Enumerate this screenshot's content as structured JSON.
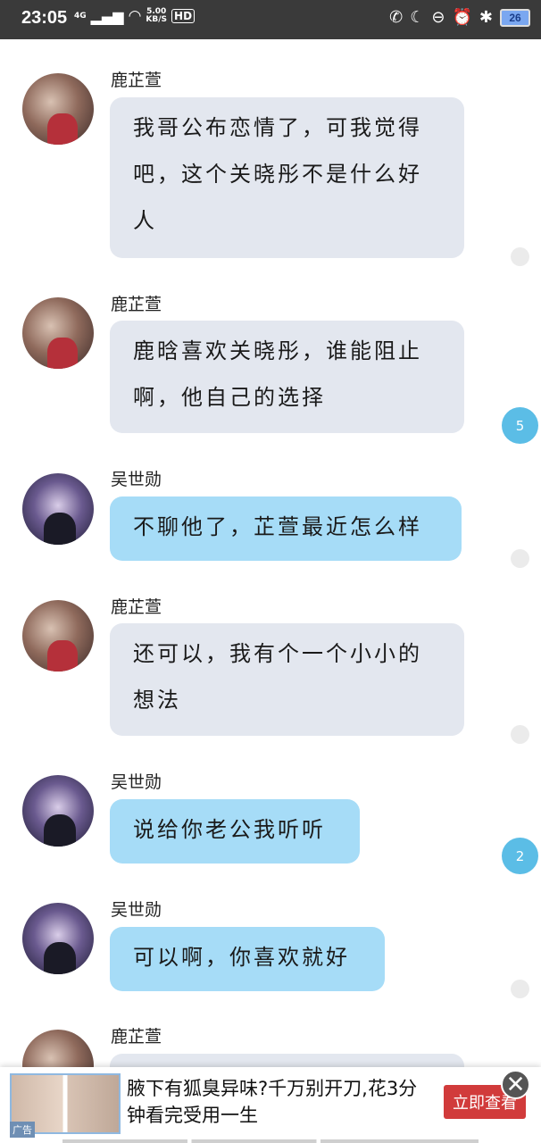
{
  "status_bar": {
    "time": "23:05",
    "network": "4G",
    "speed_value": "5.00",
    "speed_unit": "KB/S",
    "hd_label": "HD",
    "battery": "26"
  },
  "messages": [
    {
      "sender": "鹿芷萱",
      "text": "我哥公布恋情了，可我觉得吧，这个关晓彤不是什么好人"
    },
    {
      "sender": "鹿芷萱",
      "text": "鹿晗喜欢关晓彤，谁能阻止啊，他自己的选择"
    },
    {
      "sender": "吴世勋",
      "text": "不聊他了，芷萱最近怎么样"
    },
    {
      "sender": "鹿芷萱",
      "text": "还可以，我有个一个小小的想法"
    },
    {
      "sender": "吴世勋",
      "text": "说给你老公我听听"
    },
    {
      "sender": "吴世勋",
      "text": "可以啊，你喜欢就好"
    },
    {
      "sender": "鹿芷萱",
      "text": ""
    }
  ],
  "side_counts": [
    "5",
    "2"
  ],
  "ad": {
    "tag": "广告",
    "text": "腋下有狐臭异味?千万别开刀,花3分钟看完受用一生",
    "button": "立即查看",
    "close": "✕"
  },
  "colors": {
    "status_bg": "#3a3a3a",
    "bubble_gray": "#e3e7ef",
    "bubble_blue": "#a6dcf7",
    "count_badge": "#5bbde6",
    "ad_button": "#d13b3b"
  }
}
